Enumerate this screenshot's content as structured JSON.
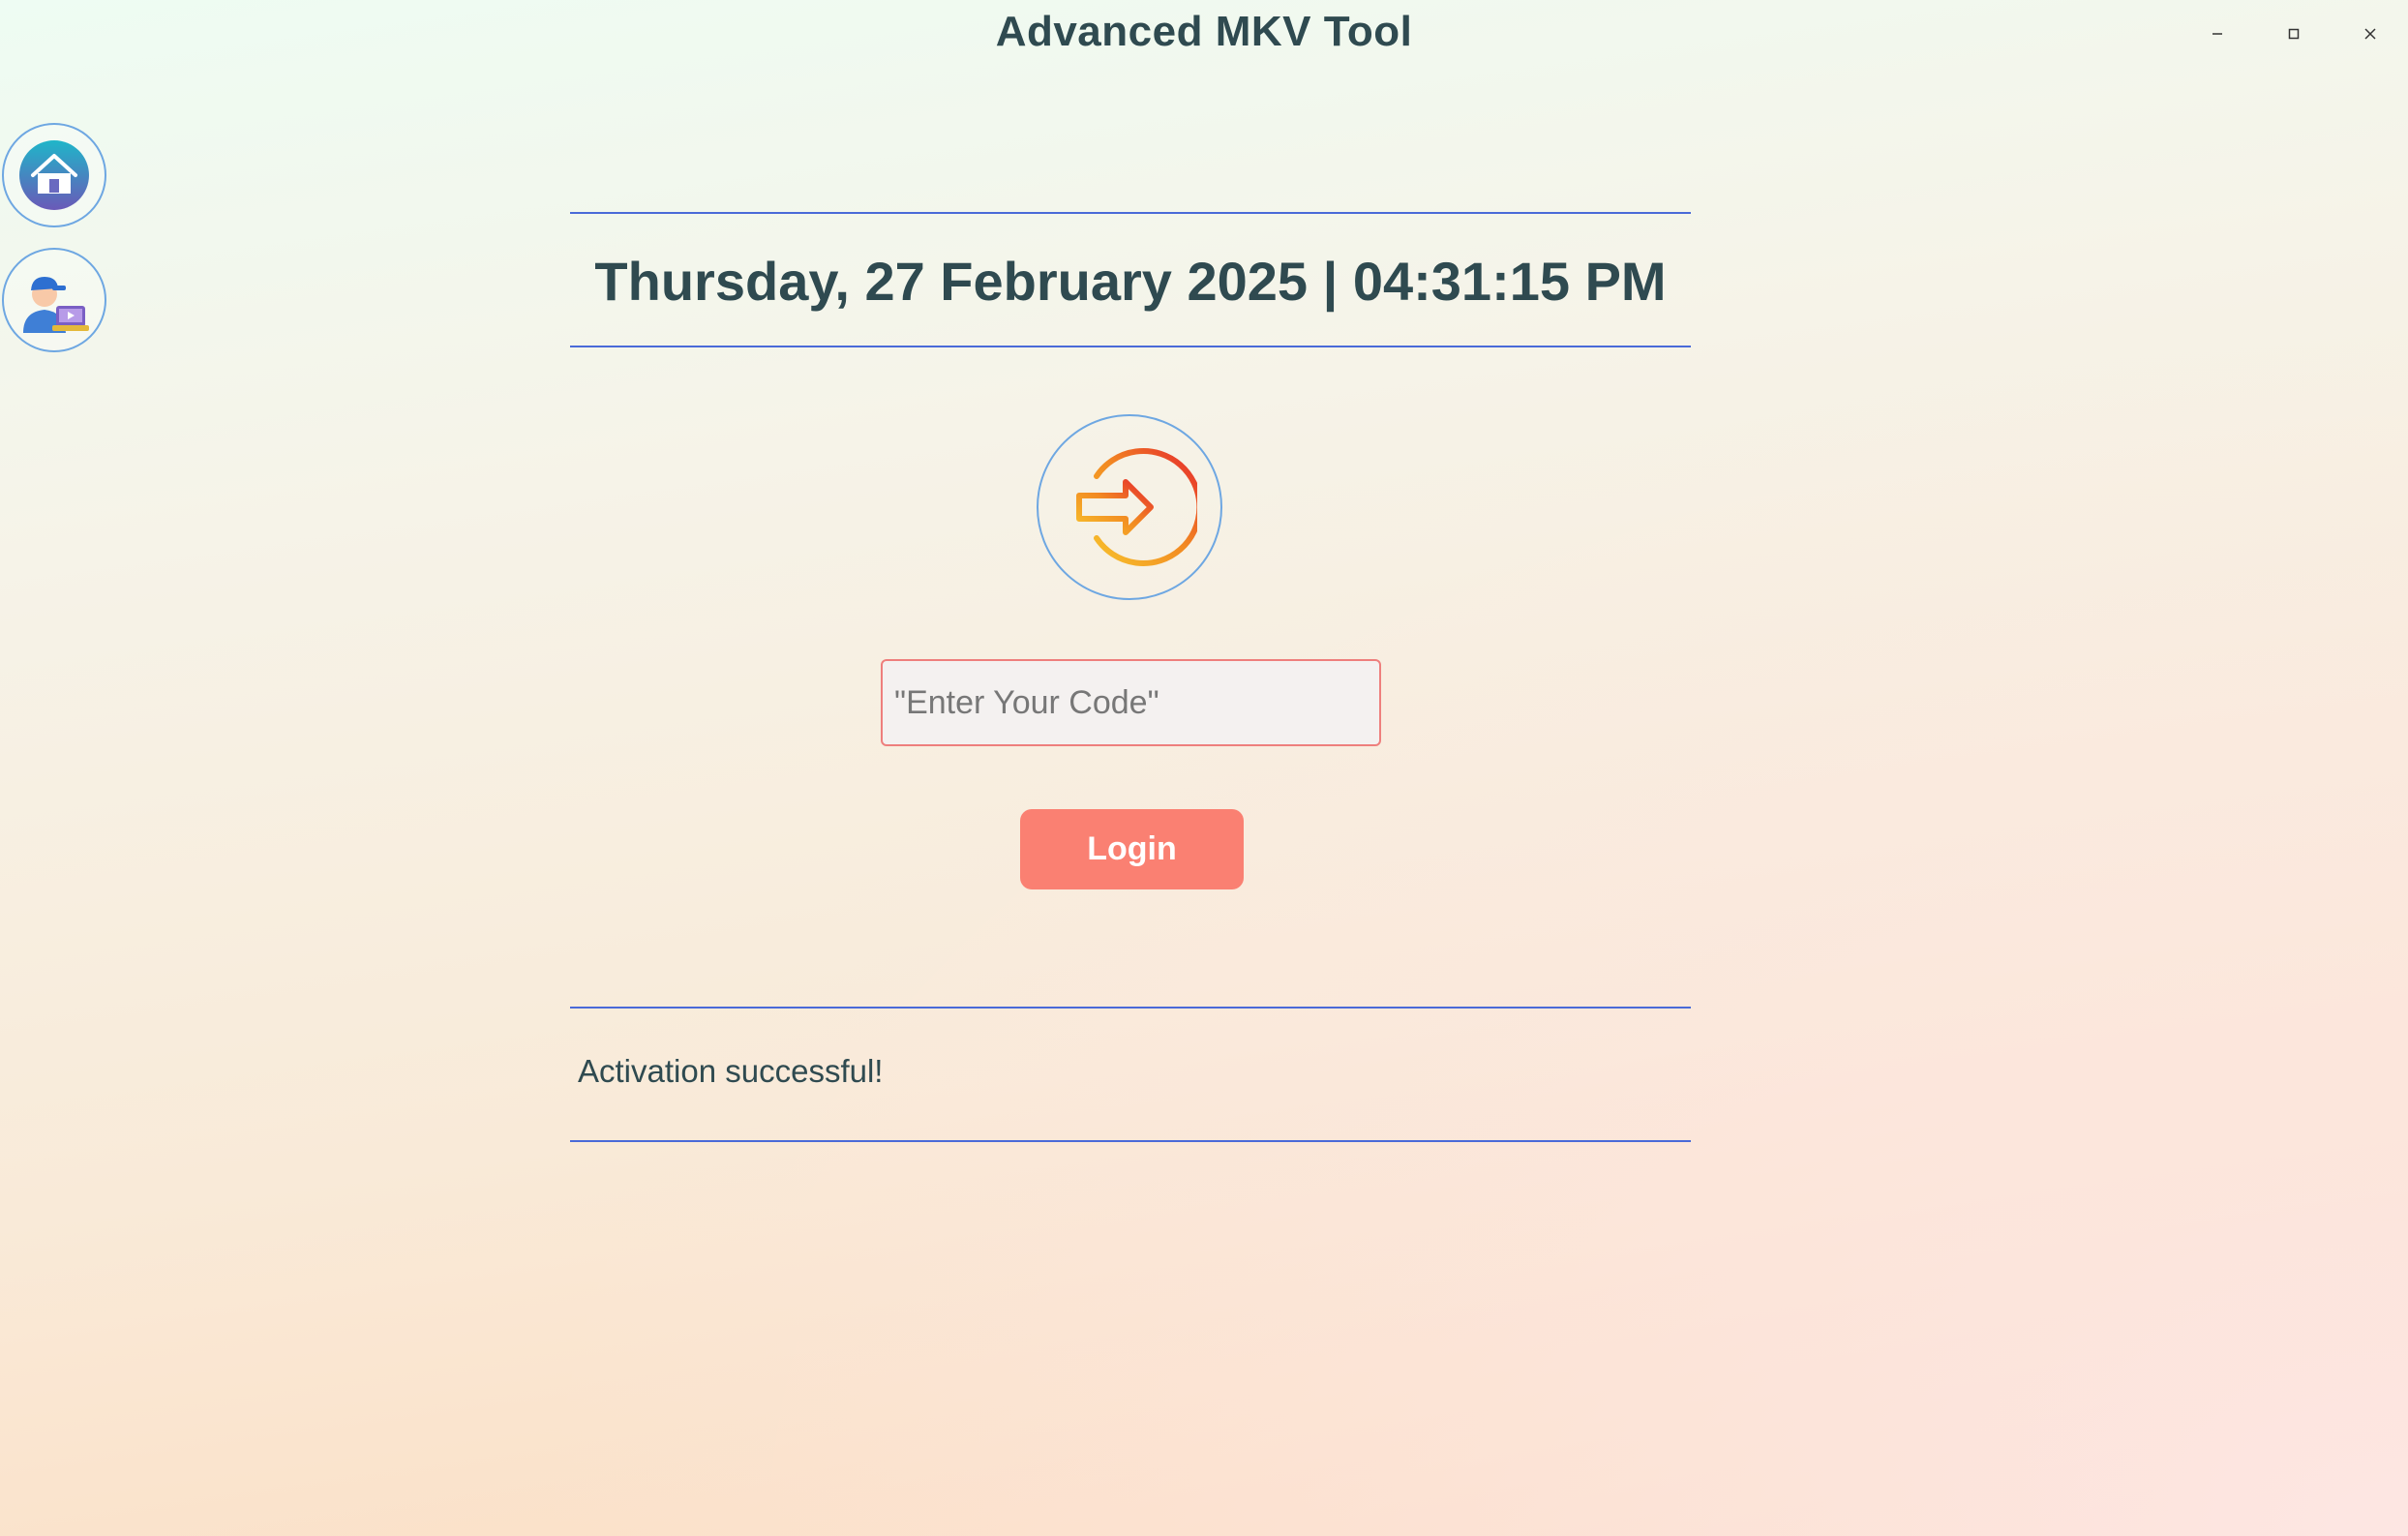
{
  "window": {
    "title": "Advanced MKV Tool",
    "controls": {
      "minimize_icon": "minimize-icon",
      "maximize_icon": "maximize-icon",
      "close_icon": "close-icon"
    }
  },
  "sidebar": {
    "items": [
      {
        "icon": "home-icon"
      },
      {
        "icon": "support-agent-icon"
      }
    ]
  },
  "main": {
    "datetime": "Thursday, 27 February 2025 | 04:31:15 PM",
    "login_icon": "login-arrow-icon",
    "code_input": {
      "placeholder": "\"Enter Your Code\"",
      "value": ""
    },
    "login_button": "Login",
    "status_message": "Activation successful!"
  },
  "colors": {
    "title_text": "#2f4a50",
    "divider": "#4a6ad8",
    "login_button": "#fa8072",
    "input_border": "#ee7f7d",
    "circle_border": "#6ea7e2"
  }
}
